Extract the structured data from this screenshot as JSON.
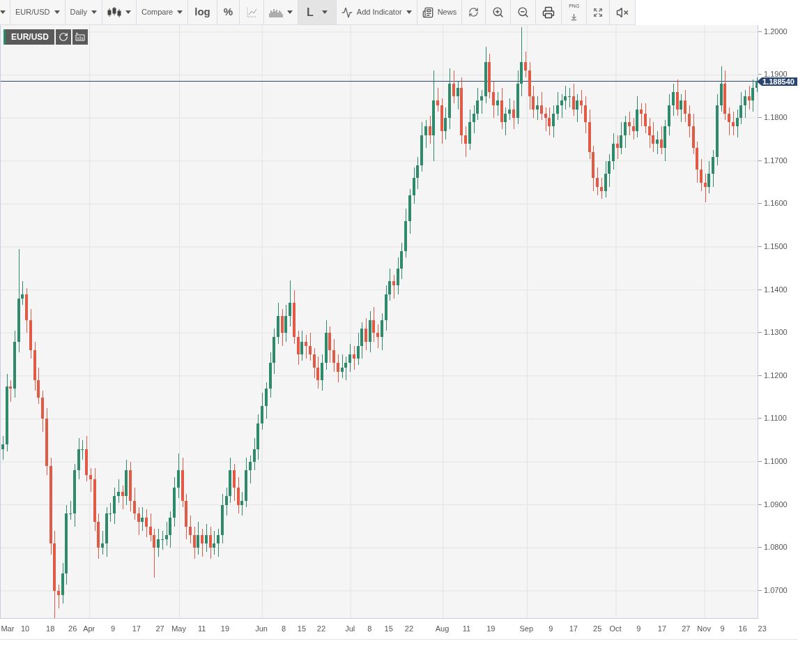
{
  "toolbar": [
    {
      "kind": "caret",
      "selected": false
    },
    {
      "kind": "menu",
      "label": "EUR/USD",
      "selected": false
    },
    {
      "kind": "menu",
      "label": "Daily",
      "selected": false
    },
    {
      "kind": "icon-menu",
      "selected": false
    },
    {
      "kind": "menu",
      "label": "Compare",
      "selected": false
    },
    {
      "kind": "text",
      "label": "log",
      "selected": false
    },
    {
      "kind": "text",
      "label": "%",
      "selected": false
    },
    {
      "kind": "icon",
      "selected": false
    },
    {
      "kind": "icon-menu",
      "selected": false
    },
    {
      "kind": "menu",
      "label": "L",
      "selected": true
    },
    {
      "kind": "icon-label-menu",
      "label": "Add Indicator",
      "selected": false
    },
    {
      "kind": "icon-label",
      "label": "News",
      "selected": false
    },
    {
      "kind": "icon",
      "selected": false
    },
    {
      "kind": "icon",
      "selected": false
    },
    {
      "kind": "icon",
      "selected": false
    },
    {
      "kind": "icon",
      "selected": false
    },
    {
      "kind": "icon-caption",
      "label": "PNG",
      "selected": false
    },
    {
      "kind": "icon",
      "selected": false
    },
    {
      "kind": "icon",
      "selected": false
    }
  ],
  "chart": {
    "symbol": "EUR/USD",
    "last_price": "1.188540",
    "date_labels": [
      "Mar",
      "10",
      "18",
      "26",
      "Apr",
      "9",
      "17",
      "27",
      "May",
      "11",
      "19",
      "Jun",
      "8",
      "15",
      "22",
      "Jul",
      "8",
      "15",
      "22",
      "Aug",
      "11",
      "19",
      "Sep",
      "9",
      "17",
      "25",
      "Oct",
      "9",
      "17",
      "27",
      "Nov",
      "9",
      "16",
      "23"
    ],
    "chart_data": {
      "type": "candlestick",
      "ylim": [
        1.0635,
        1.2016
      ],
      "grid": true,
      "ref_lines": [
        {
          "axis": "y",
          "value": 1.18854
        }
      ],
      "yticks": [
        {
          "value": 1.2,
          "label": "1.2000"
        },
        {
          "value": 1.19,
          "label": "1.1900"
        },
        {
          "value": 1.18,
          "label": "1.1800"
        },
        {
          "value": 1.17,
          "label": "1.1700"
        },
        {
          "value": 1.16,
          "label": "1.1600"
        },
        {
          "value": 1.15,
          "label": "1.1500"
        },
        {
          "value": 1.14,
          "label": "1.1400"
        },
        {
          "value": 1.13,
          "label": "1.1300"
        },
        {
          "value": 1.12,
          "label": "1.1200"
        },
        {
          "value": 1.11,
          "label": "1.1100"
        },
        {
          "value": 1.1,
          "label": "1.1000"
        },
        {
          "value": 1.09,
          "label": "1.0900"
        },
        {
          "value": 1.08,
          "label": "1.0800"
        },
        {
          "value": 1.07,
          "label": "1.0700"
        }
      ],
      "categories": [
        null,
        null,
        null,
        null,
        null,
        null,
        null,
        null,
        null,
        null,
        null,
        null,
        null,
        null,
        null,
        null,
        null,
        null,
        null,
        null,
        null,
        null,
        null,
        null,
        null,
        null,
        null,
        null,
        null,
        null,
        null,
        null,
        null,
        null,
        null,
        null,
        null,
        null,
        null,
        null,
        null,
        null,
        null,
        null,
        null,
        null,
        null,
        null,
        null,
        null,
        null,
        null,
        null,
        null,
        null,
        null,
        null,
        null,
        null,
        null,
        null,
        null,
        null,
        null,
        null,
        null,
        null,
        null,
        null,
        null,
        null,
        null,
        null,
        null,
        null,
        null,
        null,
        null,
        null,
        null,
        null,
        null,
        null,
        null,
        null,
        null,
        null,
        null,
        null,
        null,
        null,
        null,
        null,
        null,
        null,
        null,
        null,
        null,
        null,
        null,
        null,
        null,
        null,
        null,
        null,
        null,
        null,
        null,
        null,
        null,
        null,
        null,
        null,
        null,
        null,
        null,
        null,
        null,
        null,
        null,
        null,
        null,
        null,
        null,
        null,
        null,
        null,
        null,
        null,
        null,
        null,
        null,
        null,
        null,
        null,
        null,
        null,
        null,
        null,
        null,
        null,
        null,
        null,
        null,
        null,
        null,
        null,
        null,
        null,
        null,
        null,
        null,
        null,
        null,
        null,
        null,
        null,
        null,
        null,
        null,
        null,
        null,
        null,
        null,
        null,
        null,
        null,
        null,
        null,
        null,
        null,
        null,
        null,
        null,
        null,
        null,
        null,
        null,
        null,
        null,
        null,
        null,
        null,
        null,
        null,
        null,
        null,
        null,
        null,
        null
      ],
      "ohlc": [
        [
          1.103,
          1.106,
          1.1005,
          1.104
        ],
        [
          1.104,
          1.1205,
          1.1025,
          1.1175
        ],
        [
          1.1175,
          1.119,
          1.114,
          1.117
        ],
        [
          1.117,
          1.1305,
          1.115,
          1.128
        ],
        [
          1.128,
          1.1495,
          1.1255,
          1.138
        ],
        [
          1.138,
          1.142,
          1.1365,
          1.139
        ],
        [
          1.139,
          1.1405,
          1.13,
          1.133
        ],
        [
          1.133,
          1.1355,
          1.124,
          1.126
        ],
        [
          1.126,
          1.128,
          1.1165,
          1.119
        ],
        [
          1.119,
          1.122,
          1.1135,
          1.115
        ],
        [
          1.115,
          1.1165,
          1.107,
          1.11
        ],
        [
          1.11,
          1.1125,
          1.097,
          1.099
        ],
        [
          1.099,
          1.101,
          1.0785,
          1.081
        ],
        [
          1.081,
          1.084,
          1.0636,
          1.07
        ],
        [
          1.07,
          1.0715,
          1.066,
          1.069
        ],
        [
          1.069,
          1.0765,
          1.067,
          1.074
        ],
        [
          1.074,
          1.09,
          1.0715,
          1.088
        ],
        [
          1.088,
          1.091,
          1.0865,
          1.088
        ],
        [
          1.088,
          1.0995,
          1.085,
          1.098
        ],
        [
          1.098,
          1.1055,
          1.096,
          1.103
        ],
        [
          1.103,
          1.105,
          1.1005,
          1.103
        ],
        [
          1.103,
          1.106,
          1.0955,
          1.097
        ],
        [
          1.097,
          1.0985,
          1.093,
          1.096
        ],
        [
          1.096,
          1.0985,
          1.084,
          1.086
        ],
        [
          1.086,
          1.088,
          1.0775,
          1.08
        ],
        [
          1.08,
          1.084,
          1.0785,
          1.081
        ],
        [
          1.081,
          1.0895,
          1.078,
          1.088
        ],
        [
          1.088,
          1.0905,
          1.086,
          1.088
        ],
        [
          1.088,
          1.094,
          1.0855,
          1.092
        ],
        [
          1.092,
          1.096,
          1.0905,
          1.093
        ],
        [
          1.093,
          1.0945,
          1.089,
          1.092
        ],
        [
          1.092,
          1.1005,
          1.09,
          1.098
        ],
        [
          1.098,
          1.1,
          1.0885,
          1.091
        ],
        [
          1.091,
          1.094,
          1.0865,
          1.088
        ],
        [
          1.088,
          1.0895,
          1.083,
          1.086
        ],
        [
          1.086,
          1.0895,
          1.084,
          1.087
        ],
        [
          1.087,
          1.089,
          1.0825,
          1.085
        ],
        [
          1.085,
          1.088,
          1.0815,
          1.083
        ],
        [
          1.083,
          1.0845,
          1.073,
          1.08
        ],
        [
          1.08,
          1.0845,
          1.078,
          1.082
        ],
        [
          1.082,
          1.084,
          1.0795,
          1.082
        ],
        [
          1.082,
          1.086,
          1.0805,
          1.083
        ],
        [
          1.083,
          1.0885,
          1.08,
          1.087
        ],
        [
          1.087,
          1.0965,
          1.085,
          1.094
        ],
        [
          1.094,
          1.102,
          1.0915,
          1.098
        ],
        [
          1.098,
          1.101,
          1.0895,
          1.091
        ],
        [
          1.091,
          1.0925,
          1.082,
          1.085
        ],
        [
          1.085,
          1.0875,
          1.081,
          1.083
        ],
        [
          1.083,
          1.085,
          1.0775,
          1.08
        ],
        [
          1.08,
          1.086,
          1.0785,
          1.083
        ],
        [
          1.083,
          1.0845,
          1.078,
          1.081
        ],
        [
          1.081,
          1.0855,
          1.079,
          1.083
        ],
        [
          1.083,
          1.085,
          1.0775,
          1.08
        ],
        [
          1.08,
          1.084,
          1.0785,
          1.081
        ],
        [
          1.081,
          1.0845,
          1.078,
          1.083
        ],
        [
          1.083,
          1.0925,
          1.081,
          1.09
        ],
        [
          1.09,
          1.094,
          1.0875,
          1.092
        ],
        [
          1.092,
          1.101,
          1.0905,
          1.098
        ],
        [
          1.098,
          1.0995,
          1.091,
          1.094
        ],
        [
          1.094,
          1.0965,
          1.088,
          1.09
        ],
        [
          1.09,
          1.093,
          1.0875,
          1.091
        ],
        [
          1.091,
          1.101,
          1.0895,
          1.098
        ],
        [
          1.098,
          1.1015,
          1.095,
          1.1
        ],
        [
          1.1,
          1.1055,
          1.098,
          1.103
        ],
        [
          1.103,
          1.111,
          1.1005,
          1.109
        ],
        [
          1.109,
          1.116,
          1.1075,
          1.113
        ],
        [
          1.113,
          1.1185,
          1.11,
          1.117
        ],
        [
          1.117,
          1.1255,
          1.115,
          1.123
        ],
        [
          1.123,
          1.131,
          1.1205,
          1.129
        ],
        [
          1.129,
          1.137,
          1.1275,
          1.134
        ],
        [
          1.134,
          1.1355,
          1.127,
          1.13
        ],
        [
          1.13,
          1.1365,
          1.128,
          1.134
        ],
        [
          1.134,
          1.1422,
          1.1315,
          1.137
        ],
        [
          1.137,
          1.14,
          1.1275,
          1.129
        ],
        [
          1.129,
          1.1305,
          1.1225,
          1.125
        ],
        [
          1.125,
          1.1305,
          1.1235,
          1.128
        ],
        [
          1.128,
          1.1295,
          1.124,
          1.127
        ],
        [
          1.127,
          1.13,
          1.1235,
          1.125
        ],
        [
          1.125,
          1.1265,
          1.1195,
          1.122
        ],
        [
          1.122,
          1.1245,
          1.117,
          1.119
        ],
        [
          1.119,
          1.125,
          1.1165,
          1.123
        ],
        [
          1.123,
          1.133,
          1.1215,
          1.13
        ],
        [
          1.13,
          1.1315,
          1.123,
          1.126
        ],
        [
          1.126,
          1.1285,
          1.121,
          1.123
        ],
        [
          1.123,
          1.125,
          1.1185,
          1.121
        ],
        [
          1.121,
          1.125,
          1.1195,
          1.122
        ],
        [
          1.122,
          1.1245,
          1.119,
          1.123
        ],
        [
          1.123,
          1.1275,
          1.121,
          1.125
        ],
        [
          1.125,
          1.127,
          1.1215,
          1.124
        ],
        [
          1.124,
          1.13,
          1.1225,
          1.127
        ],
        [
          1.127,
          1.1325,
          1.124,
          1.131
        ],
        [
          1.131,
          1.1335,
          1.126,
          1.128
        ],
        [
          1.128,
          1.135,
          1.1255,
          1.133
        ],
        [
          1.133,
          1.136,
          1.128,
          1.13
        ],
        [
          1.13,
          1.132,
          1.1265,
          1.129
        ],
        [
          1.129,
          1.1345,
          1.126,
          1.133
        ],
        [
          1.133,
          1.141,
          1.1305,
          1.139
        ],
        [
          1.139,
          1.145,
          1.1375,
          1.142
        ],
        [
          1.142,
          1.1435,
          1.138,
          1.141
        ],
        [
          1.141,
          1.1475,
          1.139,
          1.145
        ],
        [
          1.145,
          1.151,
          1.1425,
          1.149
        ],
        [
          1.149,
          1.159,
          1.1475,
          1.156
        ],
        [
          1.156,
          1.1635,
          1.153,
          1.162
        ],
        [
          1.162,
          1.1685,
          1.16,
          1.166
        ],
        [
          1.166,
          1.171,
          1.1635,
          1.169
        ],
        [
          1.169,
          1.179,
          1.1675,
          1.176
        ],
        [
          1.176,
          1.1795,
          1.173,
          1.178
        ],
        [
          1.178,
          1.1805,
          1.174,
          1.176
        ],
        [
          1.176,
          1.191,
          1.17,
          1.184
        ],
        [
          1.184,
          1.187,
          1.1815,
          1.183
        ],
        [
          1.183,
          1.1845,
          1.174,
          1.177
        ],
        [
          1.177,
          1.1825,
          1.175,
          1.18
        ],
        [
          1.18,
          1.1916,
          1.1775,
          1.188
        ],
        [
          1.188,
          1.191,
          1.1835,
          1.185
        ],
        [
          1.185,
          1.1885,
          1.182,
          1.187
        ],
        [
          1.187,
          1.1895,
          1.174,
          1.176
        ],
        [
          1.176,
          1.178,
          1.171,
          1.174
        ],
        [
          1.174,
          1.182,
          1.1725,
          1.179
        ],
        [
          1.179,
          1.183,
          1.1765,
          1.181
        ],
        [
          1.181,
          1.187,
          1.1795,
          1.184
        ],
        [
          1.184,
          1.1865,
          1.181,
          1.185
        ],
        [
          1.185,
          1.1965,
          1.1835,
          1.193
        ],
        [
          1.193,
          1.195,
          1.1845,
          1.186
        ],
        [
          1.186,
          1.1885,
          1.18,
          1.183
        ],
        [
          1.183,
          1.186,
          1.1805,
          1.184
        ],
        [
          1.184,
          1.187,
          1.1775,
          1.179
        ],
        [
          1.179,
          1.1825,
          1.176,
          1.181
        ],
        [
          1.181,
          1.1845,
          1.1795,
          1.182
        ],
        [
          1.182,
          1.184,
          1.1775,
          1.18
        ],
        [
          1.18,
          1.191,
          1.1785,
          1.188
        ],
        [
          1.188,
          1.2011,
          1.185,
          1.193
        ],
        [
          1.193,
          1.1955,
          1.1895,
          1.191
        ],
        [
          1.191,
          1.193,
          1.182,
          1.185
        ],
        [
          1.185,
          1.1875,
          1.18,
          1.182
        ],
        [
          1.182,
          1.185,
          1.1795,
          1.183
        ],
        [
          1.183,
          1.186,
          1.1795,
          1.181
        ],
        [
          1.181,
          1.1825,
          1.177,
          1.18
        ],
        [
          1.18,
          1.1825,
          1.176,
          1.178
        ],
        [
          1.178,
          1.183,
          1.1755,
          1.181
        ],
        [
          1.181,
          1.186,
          1.1795,
          1.183
        ],
        [
          1.183,
          1.1855,
          1.18,
          1.184
        ],
        [
          1.184,
          1.1875,
          1.182,
          1.185
        ],
        [
          1.185,
          1.187,
          1.1825,
          1.185
        ],
        [
          1.185,
          1.188,
          1.1805,
          1.182
        ],
        [
          1.182,
          1.1855,
          1.179,
          1.184
        ],
        [
          1.184,
          1.1865,
          1.181,
          1.183
        ],
        [
          1.183,
          1.185,
          1.1765,
          1.179
        ],
        [
          1.179,
          1.182,
          1.1705,
          1.172
        ],
        [
          1.172,
          1.1735,
          1.163,
          1.166
        ],
        [
          1.166,
          1.1685,
          1.162,
          1.164
        ],
        [
          1.164,
          1.166,
          1.1612,
          1.163
        ],
        [
          1.163,
          1.17,
          1.1615,
          1.167
        ],
        [
          1.167,
          1.1715,
          1.164,
          1.17
        ],
        [
          1.17,
          1.1765,
          1.168,
          1.174
        ],
        [
          1.174,
          1.176,
          1.1705,
          1.173
        ],
        [
          1.173,
          1.179,
          1.1715,
          1.176
        ],
        [
          1.176,
          1.1805,
          1.173,
          1.179
        ],
        [
          1.179,
          1.1815,
          1.176,
          1.178
        ],
        [
          1.178,
          1.18,
          1.175,
          1.177
        ],
        [
          1.177,
          1.185,
          1.1755,
          1.182
        ],
        [
          1.182,
          1.1835,
          1.178,
          1.181
        ],
        [
          1.181,
          1.1835,
          1.1765,
          1.178
        ],
        [
          1.178,
          1.18,
          1.173,
          1.176
        ],
        [
          1.176,
          1.179,
          1.172,
          1.174
        ],
        [
          1.174,
          1.177,
          1.1715,
          1.175
        ],
        [
          1.175,
          1.178,
          1.1715,
          1.173
        ],
        [
          1.173,
          1.1795,
          1.17,
          1.178
        ],
        [
          1.178,
          1.1855,
          1.176,
          1.183
        ],
        [
          1.183,
          1.188,
          1.1805,
          1.186
        ],
        [
          1.186,
          1.189,
          1.1805,
          1.182
        ],
        [
          1.182,
          1.1855,
          1.179,
          1.184
        ],
        [
          1.184,
          1.1865,
          1.179,
          1.181
        ],
        [
          1.181,
          1.183,
          1.1755,
          1.178
        ],
        [
          1.178,
          1.181,
          1.1715,
          1.173
        ],
        [
          1.173,
          1.1745,
          1.165,
          1.168
        ],
        [
          1.168,
          1.1705,
          1.163,
          1.165
        ],
        [
          1.165,
          1.167,
          1.1603,
          1.164
        ],
        [
          1.164,
          1.17,
          1.1625,
          1.167
        ],
        [
          1.167,
          1.1725,
          1.164,
          1.171
        ],
        [
          1.171,
          1.1855,
          1.169,
          1.183
        ],
        [
          1.183,
          1.192,
          1.1815,
          1.188
        ],
        [
          1.188,
          1.191,
          1.1795,
          1.181
        ],
        [
          1.181,
          1.1825,
          1.176,
          1.179
        ],
        [
          1.179,
          1.1815,
          1.176,
          1.178
        ],
        [
          1.178,
          1.182,
          1.1755,
          1.18
        ],
        [
          1.18,
          1.186,
          1.1785,
          1.183
        ],
        [
          1.183,
          1.1865,
          1.18,
          1.185
        ],
        [
          1.185,
          1.1875,
          1.182,
          1.184
        ],
        [
          1.184,
          1.189,
          1.1815,
          1.187
        ],
        [
          1.187,
          1.1895,
          1.186,
          1.18854
        ]
      ]
    }
  }
}
